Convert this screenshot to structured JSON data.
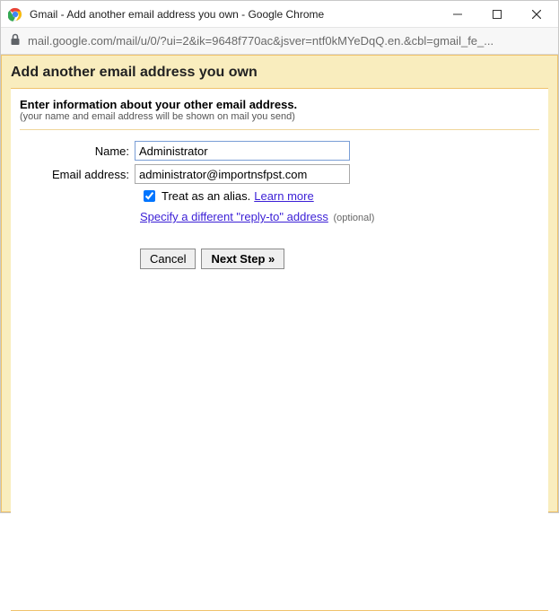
{
  "window": {
    "title": "Gmail - Add another email address you own - Google Chrome"
  },
  "addressbar": {
    "url": "mail.google.com/mail/u/0/?ui=2&ik=9648f770ac&jsver=ntf0kMYeDqQ.en.&cbl=gmail_fe_..."
  },
  "page": {
    "heading": "Add another email address you own",
    "section_title": "Enter information about your other email address.",
    "subnote": "(your name and email address will be shown on mail you send)",
    "labels": {
      "name": "Name:",
      "email": "Email address:"
    },
    "fields": {
      "name_value": "Administrator",
      "email_value": "administrator@importnsfpst.com"
    },
    "alias": {
      "checked": true,
      "label": "Treat as an alias.",
      "learn_more": "Learn more"
    },
    "replyto": {
      "link": "Specify a different \"reply-to\" address",
      "optional": "(optional)"
    },
    "buttons": {
      "cancel": "Cancel",
      "next": "Next Step »"
    }
  }
}
